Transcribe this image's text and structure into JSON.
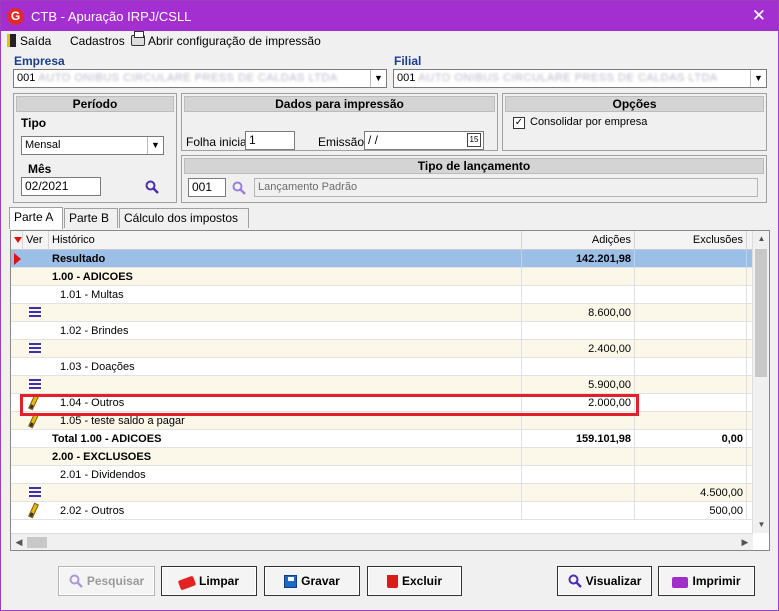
{
  "window": {
    "title": "CTB - Apuração IRPJ/CSLL",
    "close_glyph": "✕",
    "logo_letter": "G"
  },
  "menu": [
    {
      "label": "Saída",
      "icon": "exit-door-icon"
    },
    {
      "label": "Cadastros",
      "icon": ""
    },
    {
      "label": "Abrir configuração de impressão",
      "icon": "printer-icon"
    }
  ],
  "empresa": {
    "label": "Empresa",
    "value": "001",
    "blurred": "AUTO ONIBUS CIRCULARE PRESS DE CALDAS LTDA"
  },
  "filial": {
    "label": "Filial",
    "value": "001",
    "blurred": "AUTO ONIBUS CIRCULARE PRESS DE CALDAS LTDA"
  },
  "periodo": {
    "header": "Período",
    "tipo_label": "Tipo",
    "tipo_value": "Mensal",
    "mes_label": "Mês",
    "mes_value": "02/2021"
  },
  "impressao": {
    "header": "Dados para impressão",
    "folha_label": "Folha inicial",
    "folha_value": "1",
    "emissao_label": "Emissão",
    "emissao_value": " / /",
    "calendar_value": "15"
  },
  "opcoes": {
    "header": "Opções",
    "consolidar_label": "Consolidar por empresa",
    "consolidar_checked": "✓"
  },
  "lancamento": {
    "header": "Tipo de lançamento",
    "code": "001",
    "description": "Lançamento Padrão"
  },
  "tabs": [
    "Parte A",
    "Parte B",
    "Cálculo dos impostos"
  ],
  "grid": {
    "columns": {
      "ver": "Ver",
      "historico": "Histórico",
      "adicoes": "Adições",
      "exclusoes": "Exclusões"
    },
    "rows": [
      {
        "icon": "arrow",
        "historico": "Resultado",
        "adicoes": "142.201,98",
        "exclusoes": ""
      },
      {
        "icon": "",
        "historico": "1.00 - ADICOES",
        "adicoes": "",
        "exclusoes": ""
      },
      {
        "icon": "",
        "historico": "1.01 - Multas",
        "adicoes": "",
        "exclusoes": ""
      },
      {
        "icon": "list",
        "historico": "",
        "adicoes": "8.600,00",
        "exclusoes": ""
      },
      {
        "icon": "",
        "historico": "1.02 - Brindes",
        "adicoes": "",
        "exclusoes": ""
      },
      {
        "icon": "list",
        "historico": "",
        "adicoes": "2.400,00",
        "exclusoes": ""
      },
      {
        "icon": "",
        "historico": "1.03 - Doações",
        "adicoes": "",
        "exclusoes": ""
      },
      {
        "icon": "list",
        "historico": "",
        "adicoes": "5.900,00",
        "exclusoes": ""
      },
      {
        "icon": "pencil",
        "historico": "1.04 - Outros",
        "adicoes": "2.000,00",
        "exclusoes": ""
      },
      {
        "icon": "pencil",
        "historico": "1.05 - teste saldo a pagar",
        "adicoes": "",
        "exclusoes": ""
      },
      {
        "icon": "",
        "historico": "Total 1.00 - ADICOES",
        "adicoes": "159.101,98",
        "exclusoes": "0,00"
      },
      {
        "icon": "",
        "historico": "2.00 - EXCLUSOES",
        "adicoes": "",
        "exclusoes": ""
      },
      {
        "icon": "",
        "historico": "2.01 - Dividendos",
        "adicoes": "",
        "exclusoes": ""
      },
      {
        "icon": "list",
        "historico": "",
        "adicoes": "",
        "exclusoes": "4.500,00"
      },
      {
        "icon": "pencil",
        "historico": "2.02 - Outros",
        "adicoes": "",
        "exclusoes": "500,00"
      }
    ]
  },
  "buttons": {
    "pesquisar": "Pesquisar",
    "limpar": "Limpar",
    "gravar": "Gravar",
    "excluir": "Excluir",
    "visualizar": "Visualizar",
    "imprimir": "Imprimir"
  },
  "colors": {
    "titlebar": "#a42fd0",
    "section_label": "#1a3e8c",
    "selected_row": "#9cbfe8",
    "highlight_box": "#e0202a"
  }
}
